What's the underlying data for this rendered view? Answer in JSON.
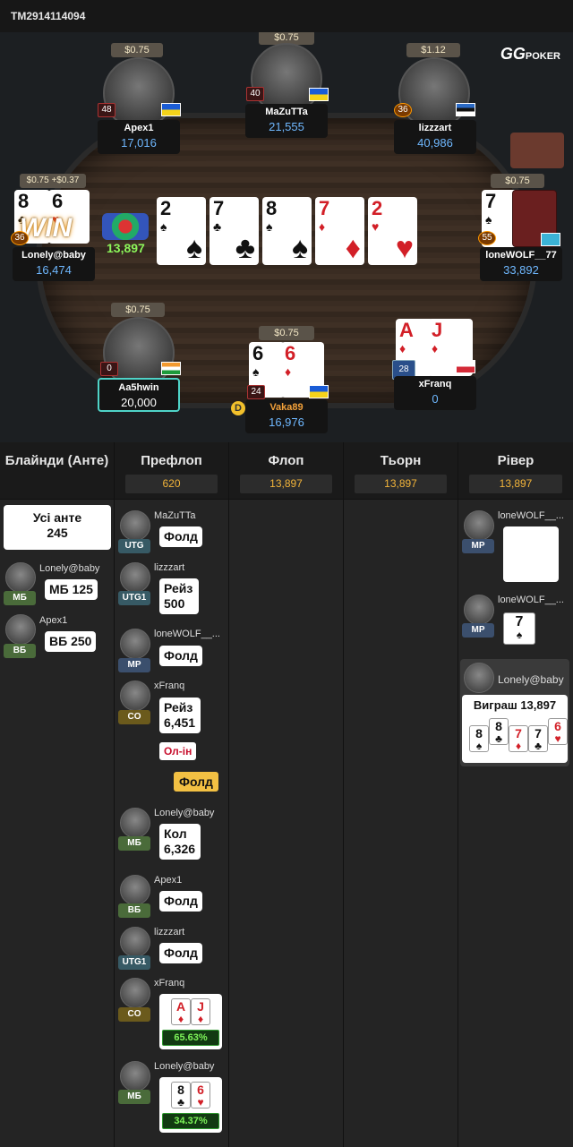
{
  "tournament_id": "TM2914114094",
  "logo": {
    "gg": "GG",
    "poker": "POKER"
  },
  "table": {
    "players": [
      {
        "name": "Apex1",
        "stack": "17,016",
        "bet": "$0.75",
        "level": "48",
        "flag": "ua"
      },
      {
        "name": "MaZuTTa",
        "stack": "21,555",
        "bet": "$0.75",
        "level": "40",
        "flag": "ua"
      },
      {
        "name": "lizzzart",
        "stack": "40,986",
        "bet": "$1.12",
        "level": "36",
        "flag": "ee"
      },
      {
        "name": "Lonely@baby",
        "stack": "16,474",
        "bet": "$0.75 +$0.37",
        "level": "36",
        "cards": [
          "8",
          "6"
        ]
      },
      {
        "name": "loneWOLF__77",
        "stack": "33,892",
        "bet": "$0.75",
        "level": "55",
        "flag": "kz",
        "card": "7"
      },
      {
        "name": "Aa5hwin",
        "stack": "20,000",
        "bet": "$0.75",
        "level": "0",
        "flag": "in"
      },
      {
        "name": "Vaka89",
        "stack": "16,976",
        "bet": "$0.75",
        "level": "24",
        "flag": "ua",
        "cards": [
          "6",
          "6"
        ]
      },
      {
        "name": "xFranq",
        "stack": "0",
        "level": "28",
        "flag": "pl",
        "cards": [
          "A",
          "J"
        ]
      }
    ],
    "pot_chips": "13,897",
    "win_text": "WIN",
    "dealer_label": "D",
    "board": [
      {
        "rank": "2",
        "suit": "♠",
        "color": "black"
      },
      {
        "rank": "7",
        "suit": "♣",
        "color": "black"
      },
      {
        "rank": "8",
        "suit": "♠",
        "color": "black"
      },
      {
        "rank": "7",
        "suit": "♦",
        "color": "red"
      },
      {
        "rank": "2",
        "suit": "♥",
        "color": "red"
      }
    ]
  },
  "history": {
    "columns": [
      {
        "title": "Блайнди (Анте)",
        "pot": ""
      },
      {
        "title": "Префлоп",
        "pot": "620"
      },
      {
        "title": "Флоп",
        "pot": "13,897"
      },
      {
        "title": "Тьорн",
        "pot": "13,897"
      },
      {
        "title": "Рівер",
        "pot": "13,897"
      }
    ],
    "blinds": {
      "all_ante_label": "Усі анте",
      "all_ante_value": "245",
      "sb_name": "Lonely@baby",
      "sb_pos": "МБ",
      "sb_action": "МБ 125",
      "bb_name": "Apex1",
      "bb_pos": "ВБ",
      "bb_action": "ВБ 250"
    },
    "preflop": [
      {
        "name": "MaZuTTa",
        "pos": "UTG",
        "action": "Фолд"
      },
      {
        "name": "lizzzart",
        "pos": "UTG1",
        "action": "Рейз 500"
      },
      {
        "name": "loneWOLF__...",
        "pos": "МР",
        "action": "Фолд"
      },
      {
        "name": "xFranq",
        "pos": "CO",
        "action": "Рейз 6,451",
        "allin": "Ол-ін",
        "fold": "Фолд"
      },
      {
        "name": "Lonely@baby",
        "pos": "МБ",
        "action": "Кол 6,326"
      },
      {
        "name": "Apex1",
        "pos": "ВБ",
        "action": "Фолд"
      },
      {
        "name": "lizzzart",
        "pos": "UTG1",
        "action": "Фолд"
      },
      {
        "name": "xFranq",
        "pos": "CO",
        "equity": "65.63%"
      },
      {
        "name": "Lonely@baby",
        "pos": "МБ",
        "equity": "34.37%"
      }
    ],
    "river": {
      "p1_name": "loneWOLF__...",
      "p1_pos": "МР",
      "p2_name": "loneWOLF__...",
      "p2_pos": "МР",
      "p2_card": "7",
      "winner_name": "Lonely@baby",
      "win_text": "Виграш 13,897"
    }
  }
}
